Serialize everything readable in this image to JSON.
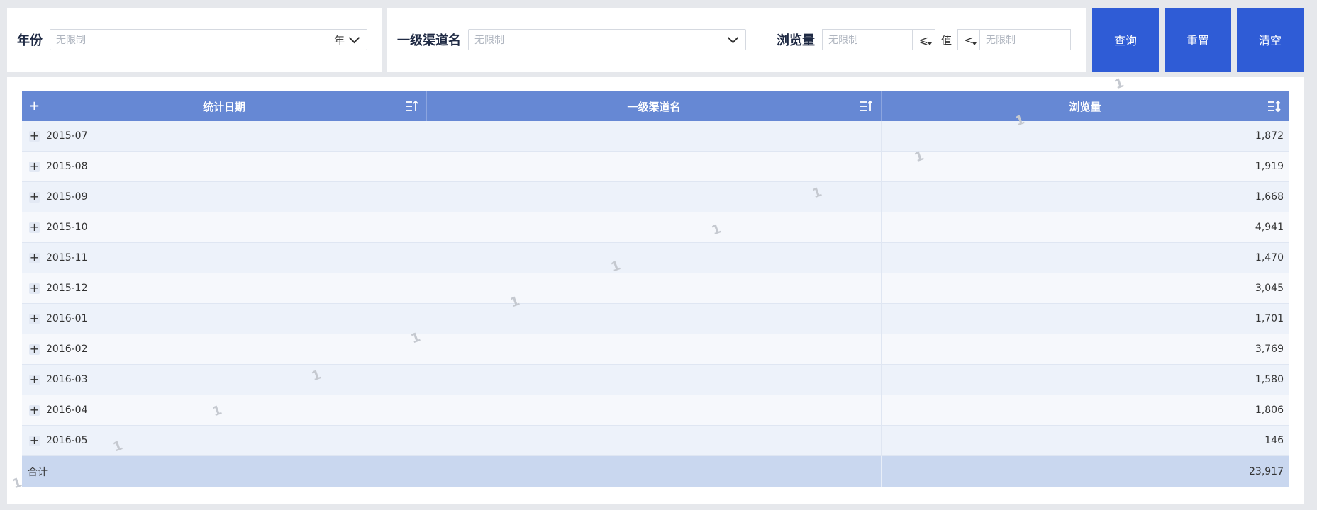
{
  "filters": {
    "year": {
      "label": "年份",
      "placeholder": "无限制",
      "unit": "年"
    },
    "channel": {
      "label": "一级渠道名",
      "placeholder": "无限制"
    },
    "views": {
      "label": "浏览量",
      "min_placeholder": "无限制",
      "op_left": "⩽",
      "value_label": "值",
      "op_right": "<",
      "max_placeholder": "无限制"
    }
  },
  "buttons": {
    "query": "查询",
    "reset": "重置",
    "clear": "清空"
  },
  "table": {
    "expand_all": "+",
    "columns": [
      "统计日期",
      "一级渠道名",
      "浏览量"
    ],
    "rows": [
      {
        "date": "2015-07",
        "channel": "",
        "views": "1,872"
      },
      {
        "date": "2015-08",
        "channel": "",
        "views": "1,919"
      },
      {
        "date": "2015-09",
        "channel": "",
        "views": "1,668"
      },
      {
        "date": "2015-10",
        "channel": "",
        "views": "4,941"
      },
      {
        "date": "2015-11",
        "channel": "",
        "views": "1,470"
      },
      {
        "date": "2015-12",
        "channel": "",
        "views": "3,045"
      },
      {
        "date": "2016-01",
        "channel": "",
        "views": "1,701"
      },
      {
        "date": "2016-02",
        "channel": "",
        "views": "3,769"
      },
      {
        "date": "2016-03",
        "channel": "",
        "views": "1,580"
      },
      {
        "date": "2016-04",
        "channel": "",
        "views": "1,806"
      },
      {
        "date": "2016-05",
        "channel": "",
        "views": "146"
      }
    ],
    "total": {
      "label": "合计",
      "views": "23,917"
    }
  },
  "watermark_text": "1"
}
